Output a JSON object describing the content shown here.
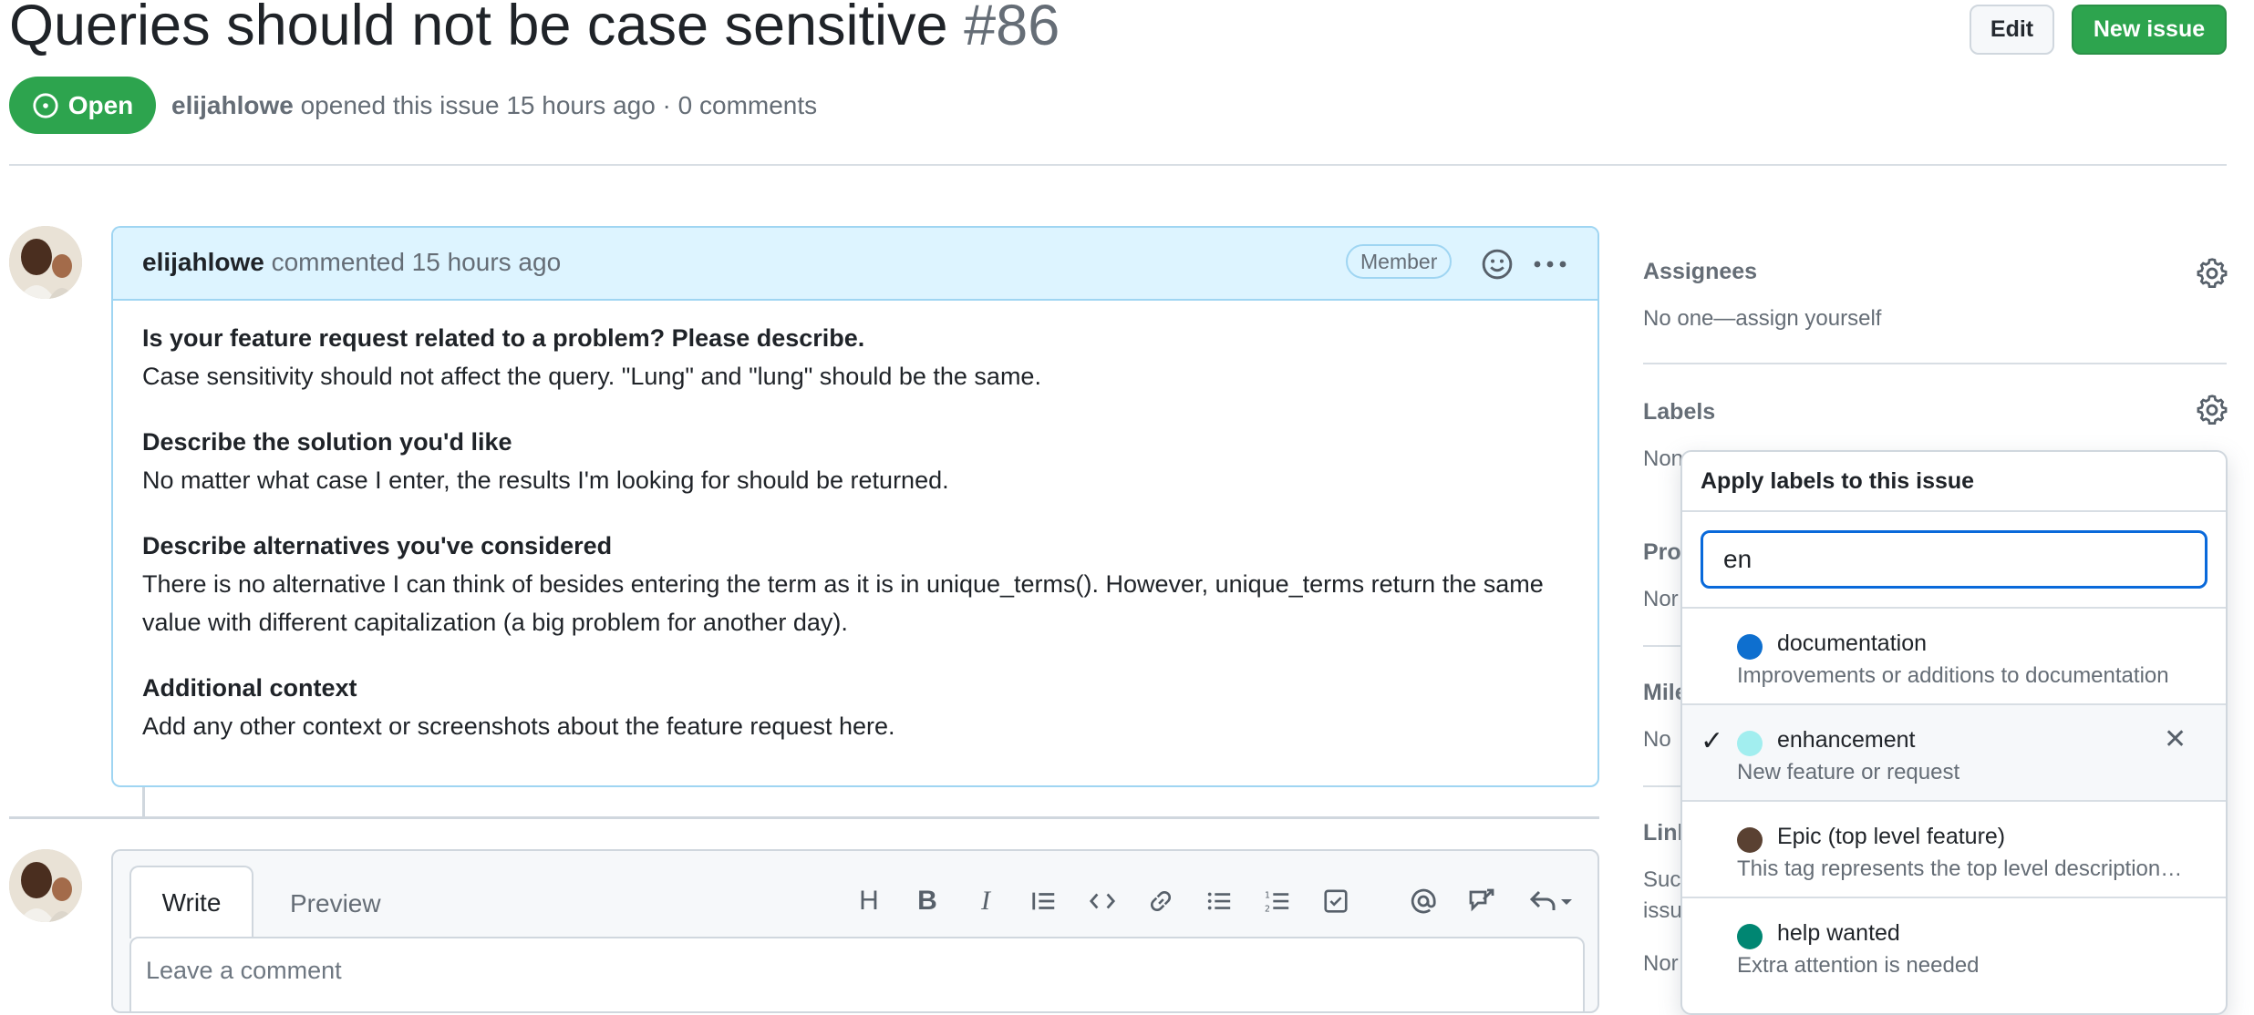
{
  "issue": {
    "title": "Queries should not be case sensitive",
    "number": "#86",
    "state": "Open",
    "author": "elijahlowe",
    "meta_rest": "opened this issue 15 hours ago · 0 comments"
  },
  "header_buttons": {
    "edit": "Edit",
    "new_issue": "New issue"
  },
  "comment": {
    "author": "elijahlowe",
    "action": "commented 15 hours ago",
    "badge": "Member",
    "sections": [
      {
        "heading": "Is your feature request related to a problem? Please describe.",
        "text": "Case sensitivity should not affect the query. \"Lung\" and \"lung\" should be the same."
      },
      {
        "heading": "Describe the solution you'd like",
        "text": "No matter what case I enter, the results I'm looking for should be returned."
      },
      {
        "heading": "Describe alternatives you've considered",
        "text": "There is no alternative I can think of besides entering the term as it is in unique_terms(). However, unique_terms return the same value with different capitalization (a big problem for another day)."
      },
      {
        "heading": "Additional context",
        "text": "Add any other context or screenshots about the feature request here."
      }
    ]
  },
  "editor": {
    "tab_write": "Write",
    "tab_preview": "Preview",
    "placeholder": "Leave a comment"
  },
  "sidebar": {
    "assignees_heading": "Assignees",
    "assignees_value": "No one—assign yourself",
    "labels_heading": "Labels",
    "labels_value_partial": "Non",
    "projects_partial": "Pro",
    "projects_value_partial": "Nor",
    "milestone_partial": "Mile",
    "milestone_value_partial": "No",
    "linked_partial": "Linl",
    "linked_text1_partial": "Suc",
    "linked_text2_partial": "issu",
    "linked_value_partial": "Nor"
  },
  "label_menu": {
    "title": "Apply labels to this issue",
    "filter_value": "en",
    "items": [
      {
        "name": "documentation",
        "desc": "Improvements or additions to documentation",
        "color": "#0e6fcf",
        "selected": false
      },
      {
        "name": "enhancement",
        "desc": "New feature or request",
        "color": "#a2eeef",
        "selected": true
      },
      {
        "name": "Epic (top level feature)",
        "desc": "This tag represents the top level description…",
        "color": "#5a4132",
        "selected": false
      },
      {
        "name": "help wanted",
        "desc": "Extra attention is needed",
        "color": "#008672",
        "selected": false
      }
    ]
  }
}
